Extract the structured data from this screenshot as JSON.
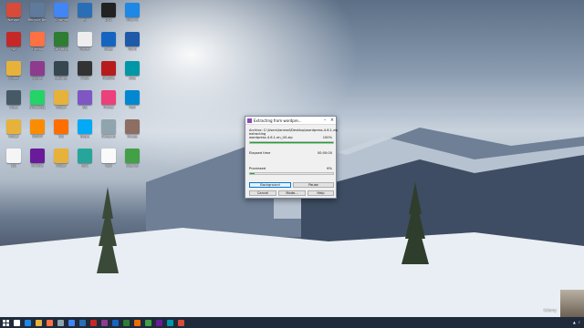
{
  "desktop": {
    "icons": [
      {
        "label": "Nerope",
        "color": "#d84a3a"
      },
      {
        "label": "Recycle Bin",
        "color": "#5f7a9a"
      },
      {
        "label": "Chrome",
        "color": "#4285f4"
      },
      {
        "label": "Ps",
        "color": "#2a6fb5"
      },
      {
        "label": "DMX",
        "color": "#222"
      },
      {
        "label": "This PC",
        "color": "#1e88e5"
      },
      {
        "label": "PDF",
        "color": "#c62828"
      },
      {
        "label": "Firefox",
        "color": "#ff7043"
      },
      {
        "label": "Camtasia",
        "color": "#2e7d32"
      },
      {
        "label": "Player",
        "color": "#eee"
      },
      {
        "label": "Edge",
        "color": "#1565c0"
      },
      {
        "label": "Word",
        "color": "#1e5aa8"
      },
      {
        "label": "Folder",
        "color": "#e6b23a"
      },
      {
        "label": "Winrar",
        "color": "#8e3b8e"
      },
      {
        "label": "Settings",
        "color": "#37474f"
      },
      {
        "label": "Photo",
        "color": "#333"
      },
      {
        "label": "FileZilla",
        "color": "#b71c1c"
      },
      {
        "label": "Snip",
        "color": "#0097a7"
      },
      {
        "label": "Video",
        "color": "#455a64"
      },
      {
        "label": "WhatsApp",
        "color": "#25d366"
      },
      {
        "label": "Folder",
        "color": "#e6b23a"
      },
      {
        "label": "Zip",
        "color": "#7e57c2"
      },
      {
        "label": "iTunes",
        "color": "#ec407a"
      },
      {
        "label": "Mail",
        "color": "#0288d1"
      },
      {
        "label": "Folder",
        "color": "#e6b23a"
      },
      {
        "label": "XAMPP",
        "color": "#fb8c00"
      },
      {
        "label": "VLC",
        "color": "#ff6f00"
      },
      {
        "label": "Skype",
        "color": "#03a9f4"
      },
      {
        "label": "Notepad",
        "color": "#90a4ae"
      },
      {
        "label": "Image",
        "color": "#8d6e63"
      },
      {
        "label": "Doc",
        "color": "#f5f5f5"
      },
      {
        "label": "Archive",
        "color": "#6a1b9a"
      },
      {
        "label": "Folder",
        "color": "#e6b23a"
      },
      {
        "label": "Paint",
        "color": "#26a69a"
      },
      {
        "label": "Text",
        "color": "#fafafa"
      },
      {
        "label": "Cleaner",
        "color": "#43a047"
      }
    ]
  },
  "dialog": {
    "title": "Extracting from wordpre...",
    "archive_line": "Archive: C:\\Users\\lanesel\\Desktop\\wordpress-4.6.1.zip",
    "action_line": "extracting",
    "file_line": "wordpress-4.6.1-en_US.zip",
    "file_percent": "100%",
    "file_progress": 1.0,
    "elapsed_label": "Elapsed time",
    "elapsed_value": "00:00:00",
    "processed_label": "Processed",
    "processed_percent": "6%",
    "processed_progress": 0.06,
    "buttons": {
      "background": "Background",
      "pause": "Pause",
      "cancel": "Cancel",
      "mode": "Mode...",
      "help": "Help"
    }
  },
  "taskbar": {
    "apps": [
      "#ffffff",
      "#1e88e5",
      "#e6b23a",
      "#ff7043",
      "#90a4ae",
      "#4285f4",
      "#2a6fb5",
      "#c62828",
      "#8e3b8e",
      "#1565c0",
      "#2e7d32",
      "#ef6c00",
      "#43a047",
      "#6a1b9a",
      "#0097a7",
      "#d84a3a"
    ],
    "tray_time": "Udemy"
  }
}
